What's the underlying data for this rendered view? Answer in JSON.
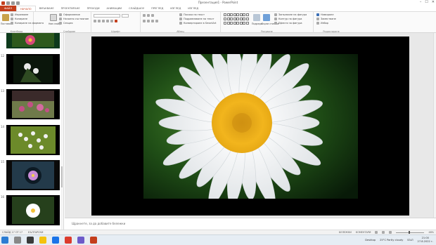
{
  "window": {
    "title": "Презентация1 - PowerPoint",
    "min": "–",
    "max": "☐",
    "close": "✕"
  },
  "tabs": [
    "ФАЙЛ",
    "НАЧАЛО",
    "ВМЪКВАНЕ",
    "ПРОЕКТИРАНЕ",
    "ПРЕХОДИ",
    "АНИМАЦИИ",
    "СЛАЙДШОУ",
    "ПРЕГЛЕД",
    "ИЗГЛЕД",
    "КОНТРОЛ"
  ],
  "ribbon": {
    "clipboard": {
      "paste": "Поставяне",
      "cut": "Изрязване",
      "copy": "Копиране",
      "format_painter": "Копиране на формата",
      "label": "Клипборд"
    },
    "slides": {
      "new_slide": "Нов слайд",
      "layout": "Оформление",
      "reset": "Начално състояние",
      "section": "Секция",
      "label": "Слайдове"
    },
    "font": {
      "label": "Шрифт"
    },
    "paragraph": {
      "text_direction": "Посока на текст",
      "align_text": "Подравняване на текст",
      "smartart": "Конвертиране в SmartArt",
      "label": "Абзац"
    },
    "drawing": {
      "arrange": "Подреди",
      "quick_styles": "Бързи стилове",
      "fill": "Запълване на фигура",
      "outline": "Контур на фигура",
      "effects": "Ефекти за фигура",
      "label": "Рисуване"
    },
    "editing": {
      "find": "Намиране",
      "replace": "Заместване",
      "select": "Избор",
      "label": "Редактиране"
    }
  },
  "thumbnails": [
    {
      "num": "",
      "palette": [
        "#0d3a1c",
        "#d94a7a",
        "#3c6b2a"
      ]
    },
    {
      "num": "12",
      "palette": [
        "#0b160b",
        "#e8e8e8",
        "#2f4a22"
      ]
    },
    {
      "num": "13",
      "palette": [
        "#3a2a2a",
        "#c34f86",
        "#8da347"
      ]
    },
    {
      "num": "14",
      "palette": [
        "#2e3b19",
        "#f0f0f0",
        "#6c8a2a"
      ]
    },
    {
      "num": "15",
      "palette": [
        "#0a0a0a",
        "#c98bd6",
        "#233a4a"
      ]
    },
    {
      "num": "16",
      "palette": [
        "#26401c",
        "#ffffff",
        "#f2c23a"
      ]
    }
  ],
  "notes_placeholder": "Щракнете, за да добавите бележки",
  "status": {
    "slide_info": "СЛАЙД 17 ОТ 17",
    "language": "БЪЛГАРСКИ",
    "notes_btn": "БЕЛЕЖКИ",
    "comments_btn": "КОМЕНТАРИ",
    "zoom": "48%"
  },
  "taskbar": {
    "desktop": "Desktop",
    "weather": "25°C  Partly cloudy",
    "lang": "БЪЛ",
    "time": "21:00",
    "date": "27.8.2022 г."
  },
  "colors": {
    "accent": "#c43e1c",
    "daisy_center": "#f2b51d",
    "petal": "#f7f7f7",
    "leaf_green": "#2d6a1e"
  }
}
